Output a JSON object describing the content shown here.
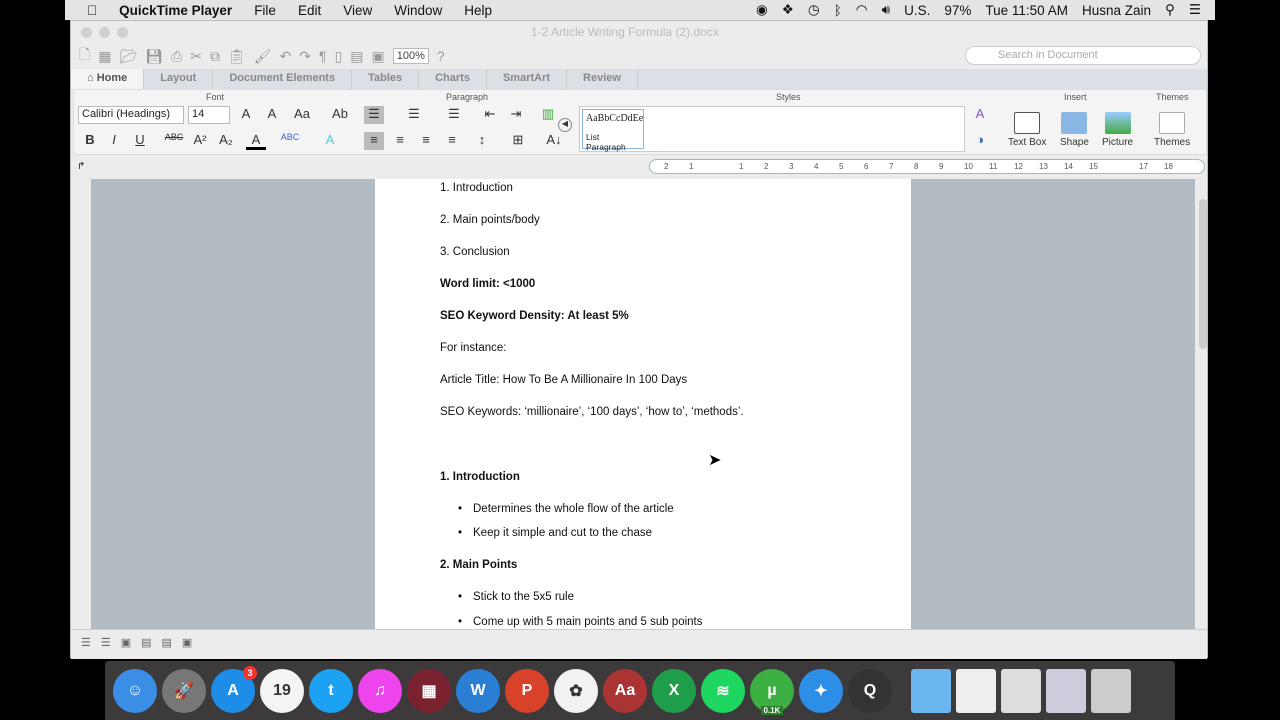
{
  "menubar": {
    "app": "QuickTime Player",
    "items": [
      "File",
      "Edit",
      "View",
      "Window",
      "Help"
    ],
    "input_source": "U.S.",
    "battery": "97%",
    "clock": "Tue 11:50 AM",
    "user": "Husna Zain"
  },
  "window": {
    "title": "1-2 Article Writing Formula (2).docx",
    "zoom": "100%",
    "search_placeholder": "Search in Document"
  },
  "tabs": [
    "Home",
    "Layout",
    "Document Elements",
    "Tables",
    "Charts",
    "SmartArt",
    "Review"
  ],
  "ribbon": {
    "font_group": "Font",
    "paragraph_group": "Paragraph",
    "styles_group": "Styles",
    "insert_group": "Insert",
    "themes_group": "Themes",
    "font_name": "Calibri (Headings)",
    "font_size": "14",
    "style_sample": "AaBbCcDdEe",
    "style_name": "List Paragraph",
    "insert": [
      "Text Box",
      "Shape",
      "Picture"
    ],
    "themes_label": "Themes"
  },
  "ruler": [
    "2",
    "1",
    "",
    "1",
    "2",
    "3",
    "4",
    "5",
    "6",
    "7",
    "8",
    "9",
    "10",
    "11",
    "12",
    "13",
    "14",
    "15",
    "",
    "17",
    "18"
  ],
  "document": {
    "lines": [
      {
        "text": "1. Introduction",
        "style": "normal"
      },
      {
        "text": "2. Main points/body",
        "style": "normal"
      },
      {
        "text": "3. Conclusion",
        "style": "normal"
      },
      {
        "text": "Word limit: <1000",
        "style": "bold"
      },
      {
        "text": "SEO Keyword Density: At least 5%",
        "style": "bold"
      },
      {
        "text": "For instance:",
        "style": "normal"
      },
      {
        "text": "Article Title: How To Be A Millionaire In 100 Days",
        "style": "normal"
      },
      {
        "text": "SEO Keywords: ‘millionaire’, ‘100 days’, ‘how to’, ‘methods’.",
        "style": "normal"
      },
      {
        "text": "1. Introduction",
        "style": "bold"
      },
      {
        "text": "Determines the whole flow of the article",
        "style": "bullet"
      },
      {
        "text": "Keep it simple and cut to the chase",
        "style": "bullet"
      },
      {
        "text": "2. Main Points",
        "style": "bold"
      },
      {
        "text": "Stick to the 5x5 rule",
        "style": "bullet"
      },
      {
        "text": "Come up with 5 main points and 5 sub points",
        "style": "bullet"
      }
    ]
  },
  "dock": {
    "apps": [
      {
        "name": "finder",
        "color": "#3a8ee6",
        "glyph": "☺"
      },
      {
        "name": "launchpad",
        "color": "#777",
        "glyph": "🚀"
      },
      {
        "name": "app-store",
        "color": "#1d8de8",
        "glyph": "A",
        "badge": "3"
      },
      {
        "name": "calendar",
        "color": "#f4f4f4",
        "glyph": "19"
      },
      {
        "name": "twitter",
        "color": "#1da1f2",
        "glyph": "t"
      },
      {
        "name": "itunes",
        "color": "#e4e",
        "glyph": "♫"
      },
      {
        "name": "photo-booth",
        "color": "#7a2230",
        "glyph": "▦"
      },
      {
        "name": "word",
        "color": "#2a7fd4",
        "glyph": "W"
      },
      {
        "name": "powerpoint",
        "color": "#d8422b",
        "glyph": "P"
      },
      {
        "name": "photos",
        "color": "#f2f2f2",
        "glyph": "✿"
      },
      {
        "name": "dictionary",
        "color": "#a33",
        "glyph": "Aa"
      },
      {
        "name": "excel",
        "color": "#1e9e4a",
        "glyph": "X"
      },
      {
        "name": "spotify",
        "color": "#1ed760",
        "glyph": "≋"
      },
      {
        "name": "utorrent",
        "color": "#3cb043",
        "glyph": "µ",
        "label": "0.1K"
      },
      {
        "name": "safari",
        "color": "#2d8ee8",
        "glyph": "✦"
      },
      {
        "name": "quicktime",
        "color": "#333",
        "glyph": "Q"
      },
      {
        "name": "folder",
        "color": "#6cb6f0",
        "glyph": ""
      },
      {
        "name": "pdf-file",
        "color": "#eee",
        "glyph": ""
      },
      {
        "name": "window-thumbnail",
        "color": "#ddd",
        "glyph": ""
      },
      {
        "name": "window-thumbnail-2",
        "color": "#ccd",
        "glyph": ""
      },
      {
        "name": "trash",
        "color": "#ccc",
        "glyph": ""
      }
    ]
  }
}
